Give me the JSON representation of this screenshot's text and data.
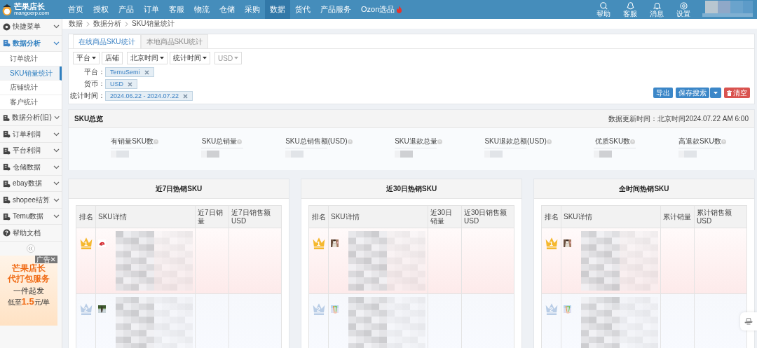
{
  "logo": {
    "name": "芒果店长",
    "domain": "mangoerp.com"
  },
  "nav": [
    {
      "label": "首页",
      "selected": false,
      "hot": false
    },
    {
      "label": "授权",
      "selected": false,
      "hot": false
    },
    {
      "label": "产品",
      "selected": false,
      "hot": false
    },
    {
      "label": "订单",
      "selected": false,
      "hot": false
    },
    {
      "label": "客服",
      "selected": false,
      "hot": false
    },
    {
      "label": "物流",
      "selected": false,
      "hot": false
    },
    {
      "label": "仓储",
      "selected": false,
      "hot": false
    },
    {
      "label": "采购",
      "selected": false,
      "hot": false
    },
    {
      "label": "数据",
      "selected": true,
      "hot": false
    },
    {
      "label": "货代",
      "selected": false,
      "hot": false
    },
    {
      "label": "产品服务",
      "selected": false,
      "hot": false
    },
    {
      "label": "Ozon选品",
      "selected": false,
      "hot": true
    }
  ],
  "top_actions": [
    {
      "kind": "search",
      "label": "帮助"
    },
    {
      "kind": "support",
      "label": "客服"
    },
    {
      "kind": "bell",
      "label": "消息"
    },
    {
      "kind": "gear",
      "label": "设置"
    }
  ],
  "sidebar": {
    "items": [
      {
        "label": "快捷菜单",
        "kind": "shortcut",
        "expanded": false
      },
      {
        "label": "数据分析",
        "kind": "group",
        "expanded": true,
        "children": [
          {
            "label": "订单统计",
            "selected": false
          },
          {
            "label": "SKU销量统计",
            "selected": true
          },
          {
            "label": "店铺统计",
            "selected": false
          },
          {
            "label": "客户统计",
            "selected": false
          }
        ]
      },
      {
        "label": "数据分析(旧)",
        "kind": "group",
        "expanded": false
      },
      {
        "label": "订单利润",
        "kind": "group",
        "expanded": false
      },
      {
        "label": "平台利润",
        "kind": "group",
        "expanded": false
      },
      {
        "label": "仓储数据",
        "kind": "group",
        "expanded": false
      },
      {
        "label": "ebay数据",
        "kind": "group",
        "expanded": false
      },
      {
        "label": "shopee结算",
        "kind": "group",
        "expanded": false
      },
      {
        "label": "Temu数据",
        "kind": "group",
        "expanded": false
      },
      {
        "label": "帮助文档",
        "kind": "help"
      }
    ]
  },
  "ad": {
    "badge": "广告",
    "close": "✕",
    "title": "芒果店长",
    "subtitle": "代打包服务",
    "tagline": "一件起发",
    "price_prefix": "低至",
    "price": "1.5",
    "price_suffix": "元/单"
  },
  "breadcrumb": [
    "数据",
    "数据分析",
    "SKU销量统计"
  ],
  "filter": {
    "tabs": [
      {
        "label": "在线商品SKU统计",
        "selected": true
      },
      {
        "label": "本地商品SKU统计",
        "selected": false
      }
    ],
    "dropdowns": [
      {
        "label": "平台",
        "caret": true,
        "disabled": false
      },
      {
        "label": "店铺",
        "caret": false,
        "disabled": false
      },
      {
        "label": "北京时间",
        "caret": true,
        "disabled": false
      },
      {
        "label": "统计时间",
        "caret": true,
        "disabled": false
      },
      {
        "label": "USD",
        "caret": true,
        "disabled": true
      }
    ],
    "conditions": [
      {
        "label": "平台：",
        "value": "TemuSemi"
      },
      {
        "label": "货币：",
        "value": "USD"
      },
      {
        "label": "统计时间：",
        "value": "2024.06.22 - 2024.07.22"
      }
    ],
    "actions": [
      {
        "kind": "export",
        "label": "导出"
      },
      {
        "kind": "save",
        "label": "保存搜索"
      },
      {
        "kind": "clear",
        "label": "清空"
      }
    ]
  },
  "overview": {
    "title": "SKU总览",
    "updated": "数据更新时间：北京时间2024.07.22 AM 6:00",
    "metrics": [
      {
        "label": "有销量SKU数"
      },
      {
        "label": "SKU总销量"
      },
      {
        "label": "SKU总销售额(USD)"
      },
      {
        "label": "SKU退款总量"
      },
      {
        "label": "SKU退款总额(USD)"
      },
      {
        "label": "优质SKU数"
      },
      {
        "label": "高退款SKU数"
      }
    ]
  },
  "panels": [
    {
      "title": "近7日热销SKU",
      "columns": [
        "排名",
        "SKU详情",
        "近7日销量",
        "近7日销售额USD"
      ],
      "rows": [
        {
          "rank": "1"
        },
        {
          "rank": "2"
        }
      ]
    },
    {
      "title": "近30日热销SKU",
      "columns": [
        "排名",
        "SKU详情",
        "近30日销量",
        "近30日销售额USD"
      ],
      "rows": [
        {
          "rank": "1"
        },
        {
          "rank": "2"
        }
      ]
    },
    {
      "title": "全时间热销SKU",
      "columns": [
        "排名",
        "SKU详情",
        "累计销量",
        "累计销售额 USD"
      ],
      "rows": [
        {
          "rank": "1"
        },
        {
          "rank": "2"
        }
      ]
    }
  ]
}
